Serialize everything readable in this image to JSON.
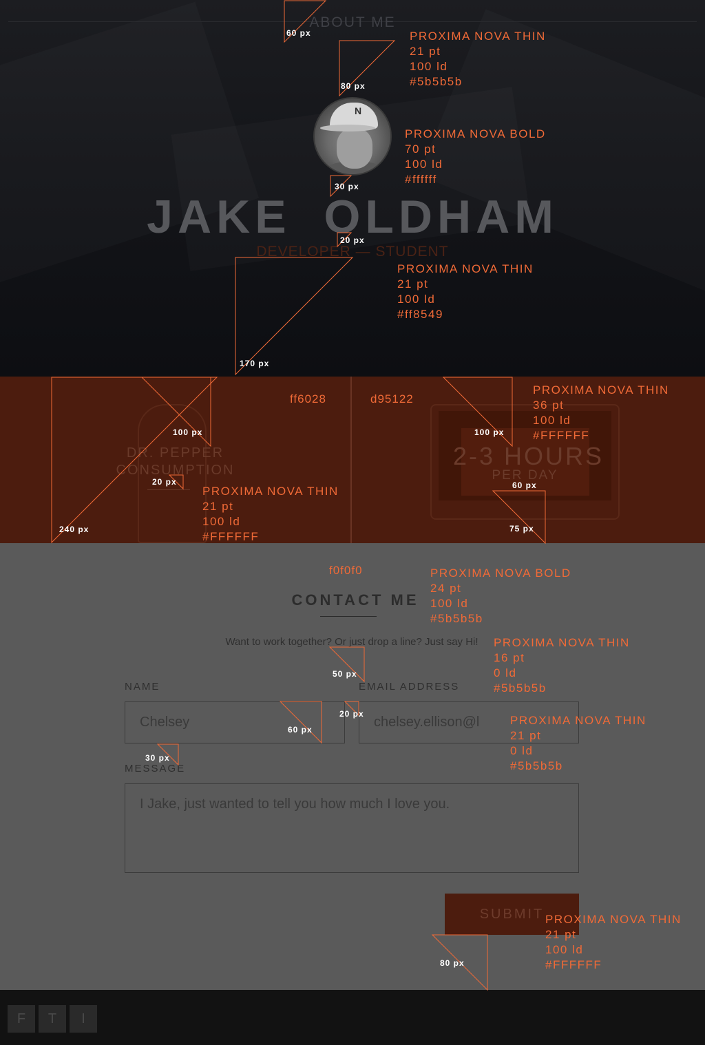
{
  "nav": {
    "about": "ABOUT ME"
  },
  "hero": {
    "name": "JAKE OLDHAM",
    "role": "DEVELOPER — STUDENT",
    "avatar_cap_letter": "N"
  },
  "stats": [
    {
      "label_line1": "DR. PEPPER",
      "label_line2": "CONSUMPTION",
      "color_label": "ff6028"
    },
    {
      "value": "2-3 HOURS",
      "unit": "PER DAY",
      "color_label": "d95122"
    }
  ],
  "contact": {
    "bg_label": "f0f0f0",
    "title": "CONTACT ME",
    "subtitle": "Want to work together? Or just drop a line? Just say Hi!",
    "name_label": "NAME",
    "name_value": "Chelsey",
    "email_label": "EMAIL ADDRESS",
    "email_value": "chelsey.ellison@l",
    "message_label": "MESSAGE",
    "message_value": "I Jake, just wanted to tell you how much I love you.",
    "submit": "SUBMIT"
  },
  "footer": {
    "social": [
      "F",
      "T",
      "I"
    ]
  },
  "specs": {
    "about": [
      "PROXIMA NOVA THIN",
      "21 pt",
      "100 ld",
      "#5b5b5b"
    ],
    "name": [
      "PROXIMA NOVA BOLD",
      "70 pt",
      "100 ld",
      "#ffffff"
    ],
    "role": [
      "PROXIMA NOVA THIN",
      "21 pt",
      "100 ld",
      "#ff8549"
    ],
    "hours": [
      "PROXIMA NOVA THIN",
      "36 pt",
      "100 ld",
      "#FFFFFF"
    ],
    "stat_label": [
      "PROXIMA NOVA THIN",
      "21 pt",
      "100 ld",
      "#FFFFFF"
    ],
    "contact_title": [
      "PROXIMA NOVA BOLD",
      "24 pt",
      "100 ld",
      "#5b5b5b"
    ],
    "subtitle": [
      "PROXIMA NOVA THIN",
      "16 pt",
      "0 ld",
      "#5b5b5b"
    ],
    "input": [
      "PROXIMA NOVA THIN",
      "21 pt",
      "0 ld",
      "#5b5b5b"
    ],
    "submit": [
      "PROXIMA NOVA THIN",
      "21 pt",
      "100 ld",
      "#FFFFFF"
    ]
  },
  "measures": {
    "m60a": "60 px",
    "m80a": "80 px",
    "m30a": "30 px",
    "m20a": "20 px",
    "m170": "170 px",
    "m100a": "100 px",
    "m20b": "20 px",
    "m240": "240 px",
    "m100b": "100 px",
    "m60b": "60 px",
    "m75": "75 px",
    "m50": "50 px",
    "m60c": "60 px",
    "m20c": "20 px",
    "m30b": "30 px",
    "m80b": "80 px"
  },
  "colors": {
    "accent": "#f06a37",
    "band": "#4c1c0e",
    "hero_bg": "#141519",
    "contact_bg": "#5a5a5a",
    "footer_bg": "#121212"
  }
}
